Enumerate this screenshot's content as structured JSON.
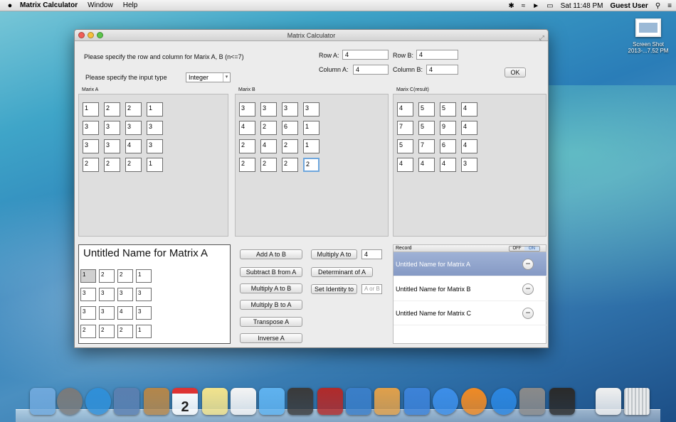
{
  "menubar": {
    "apple": "",
    "app_name": "Matrix Calculator",
    "menus": [
      "Window",
      "Help"
    ],
    "clock": "Sat 11:48 PM",
    "user": "Guest User"
  },
  "desktop": {
    "icon_label_1": "Screen Shot",
    "icon_label_2": "2013-...7.52 PM"
  },
  "window": {
    "title": "Matrix Calculator",
    "prompt_rows": "Please specify the row and column for Marix A, B (n<=7)",
    "prompt_type": "Please specify the input type",
    "input_type": "Integer",
    "row_a_label": "Row A:",
    "row_a": "4",
    "col_a_label": "Column A:",
    "col_a": "4",
    "row_b_label": "Row B:",
    "row_b": "4",
    "col_b_label": "Column B:",
    "col_b": "4",
    "ok": "OK",
    "matrix_a_label": "Marix A",
    "matrix_b_label": "Marix B",
    "matrix_c_label": "Marix C(result)",
    "matrix_a": [
      [
        "1",
        "2",
        "2",
        "1"
      ],
      [
        "3",
        "3",
        "3",
        "3"
      ],
      [
        "3",
        "3",
        "4",
        "3"
      ],
      [
        "2",
        "2",
        "2",
        "1"
      ]
    ],
    "matrix_b": [
      [
        "3",
        "3",
        "3",
        "3"
      ],
      [
        "4",
        "2",
        "6",
        "1"
      ],
      [
        "2",
        "4",
        "2",
        "1"
      ],
      [
        "2",
        "2",
        "2",
        "2"
      ]
    ],
    "matrix_c": [
      [
        "4",
        "5",
        "5",
        "4"
      ],
      [
        "7",
        "5",
        "9",
        "4"
      ],
      [
        "5",
        "7",
        "6",
        "4"
      ],
      [
        "4",
        "4",
        "4",
        "3"
      ]
    ],
    "name_title": "Untitled Name for Matrix A",
    "name_matrix": [
      [
        "1",
        "2",
        "2",
        "1"
      ],
      [
        "3",
        "3",
        "3",
        "3"
      ],
      [
        "3",
        "3",
        "4",
        "3"
      ],
      [
        "2",
        "2",
        "2",
        "1"
      ]
    ],
    "buttons": {
      "add": "Add A to B",
      "subtract": "Subtract B from A",
      "mult_ab": "Multiply A to B",
      "mult_ba": "Multiply B to A",
      "transpose": "Transpose A",
      "inverse": "Inverse A",
      "mult_scalar": "Multiply A to",
      "determinant": "Determinant of A",
      "set_identity": "Set Identity to"
    },
    "scalar_value": "4",
    "identity_placeholder": "A or B",
    "record": {
      "title": "Record",
      "toggle_off": "OFF",
      "toggle_on": "ON",
      "items": [
        "Untitled Name for Matrix A",
        "Untitled Name for Matrix B",
        "Untitled Name for Matrix C"
      ],
      "remove_symbol": "−"
    }
  },
  "dock": {
    "apps": [
      "Finder",
      "Launchpad",
      "Safari",
      "Mail",
      "Contacts",
      "Calendar",
      "Notes",
      "Reminders",
      "Messages",
      "FaceTime",
      "Photo Booth",
      "iPhoto",
      "Preview",
      "Keynote",
      "iTunes",
      "iBooks",
      "App Store",
      "System Preferences",
      "Matrix Calculator",
      "Document",
      "Trash"
    ],
    "calendar_day": "2",
    "colors": [
      "#6fa8dc",
      "#7a7a7a",
      "#2f8fd8",
      "#5a7fb0",
      "#b4864a",
      "#ffffff",
      "#f2e38c",
      "#f4f4f4",
      "#5fb2ef",
      "#3a3a3a",
      "#b12a2a",
      "#3a7ec8",
      "#e0a04a",
      "#3c82d8",
      "#3c8ee8",
      "#f08a24",
      "#2b86e0",
      "#8a8a8a",
      "#2a2a2a",
      "#f0f0f0",
      "#c8c8c8"
    ]
  }
}
